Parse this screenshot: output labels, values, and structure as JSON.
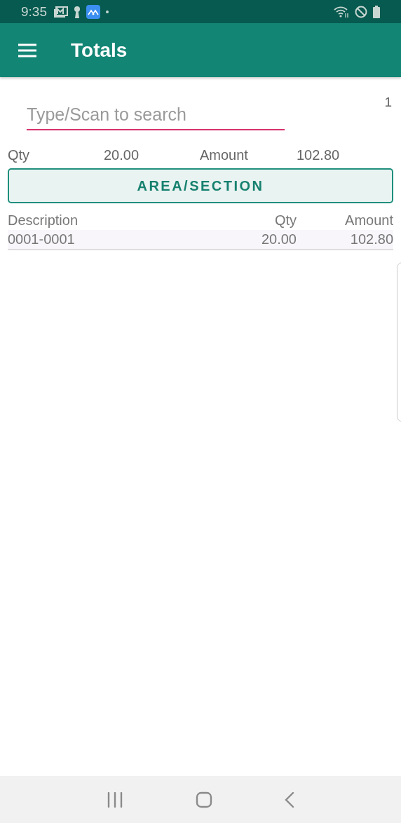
{
  "status_bar": {
    "time": "9:35"
  },
  "app_bar": {
    "title": "Totals"
  },
  "search": {
    "placeholder": "Type/Scan to search"
  },
  "count": "1",
  "totals": {
    "qty_label": "Qty",
    "qty": "20.00",
    "amount_label": "Amount",
    "amount": "102.80"
  },
  "area_button": "AREA/SECTION",
  "table": {
    "columns": [
      "Description",
      "Qty",
      "Amount"
    ],
    "rows": [
      {
        "description": "0001-0001",
        "qty": "20.00",
        "amount": "102.80"
      }
    ]
  }
}
